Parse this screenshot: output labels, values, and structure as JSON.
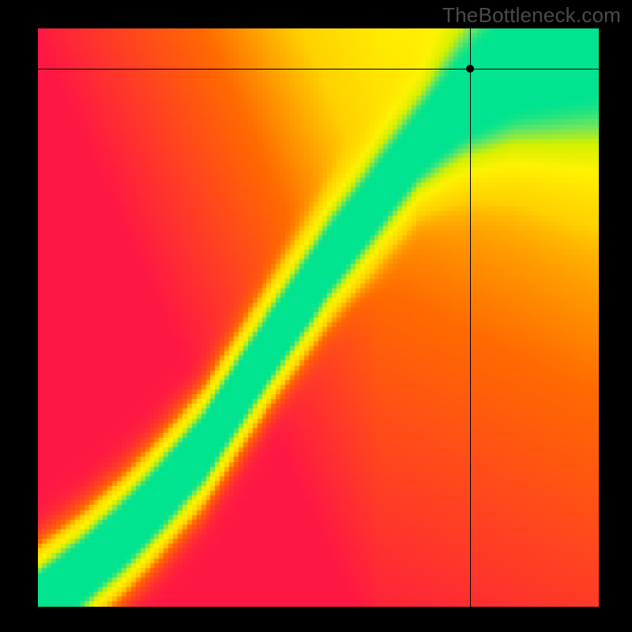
{
  "watermark": "TheBottleneck.com",
  "chart_data": {
    "type": "heatmap",
    "title": "",
    "xlabel": "",
    "ylabel": "",
    "xlim": [
      0,
      100
    ],
    "ylim": [
      0,
      100
    ],
    "crosshair": {
      "x": 77,
      "y": 93
    },
    "ridge": [
      {
        "x": 0,
        "y": 0
      },
      {
        "x": 8,
        "y": 6
      },
      {
        "x": 15,
        "y": 12
      },
      {
        "x": 22,
        "y": 19
      },
      {
        "x": 30,
        "y": 28
      },
      {
        "x": 38,
        "y": 40
      },
      {
        "x": 45,
        "y": 50
      },
      {
        "x": 52,
        "y": 60
      },
      {
        "x": 60,
        "y": 70
      },
      {
        "x": 68,
        "y": 80
      },
      {
        "x": 76,
        "y": 88
      },
      {
        "x": 85,
        "y": 94
      },
      {
        "x": 100,
        "y": 100
      }
    ],
    "ridge_width_base": 4.5,
    "ridge_width_wide_start_x": 68,
    "ridge_width_wide": 11,
    "color_stops": [
      {
        "t": 0.0,
        "color": "#ff1744"
      },
      {
        "t": 0.35,
        "color": "#ff6a00"
      },
      {
        "t": 0.55,
        "color": "#ffd100"
      },
      {
        "t": 0.75,
        "color": "#fff202"
      },
      {
        "t": 0.88,
        "color": "#d2f000"
      },
      {
        "t": 0.95,
        "color": "#6be560"
      },
      {
        "t": 1.0,
        "color": "#00e48f"
      }
    ],
    "pixelation": 120
  }
}
